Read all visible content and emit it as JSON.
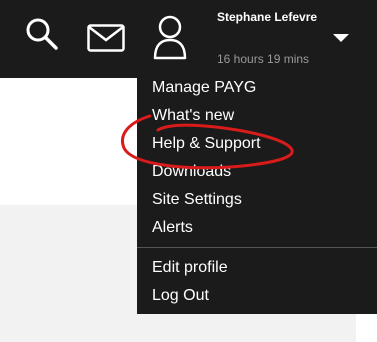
{
  "header": {
    "user_name": "Stephane Lefevre",
    "session_time": "16 hours 19 mins",
    "icons": [
      "search-icon",
      "mail-icon",
      "user-icon",
      "caret-down-icon"
    ]
  },
  "dropdown": {
    "items": [
      {
        "label": "Manage PAYG"
      },
      {
        "label": "What's new"
      },
      {
        "label": "Help & Support"
      },
      {
        "label": "Downloads"
      },
      {
        "label": "Site Settings"
      },
      {
        "label": "Alerts"
      }
    ],
    "secondary_items": [
      {
        "label": "Edit profile"
      },
      {
        "label": "Log Out"
      }
    ]
  },
  "colors": {
    "bar_background": "#1b1b1b",
    "menu_text": "#ffffff",
    "annotation": "#d81b1b"
  }
}
